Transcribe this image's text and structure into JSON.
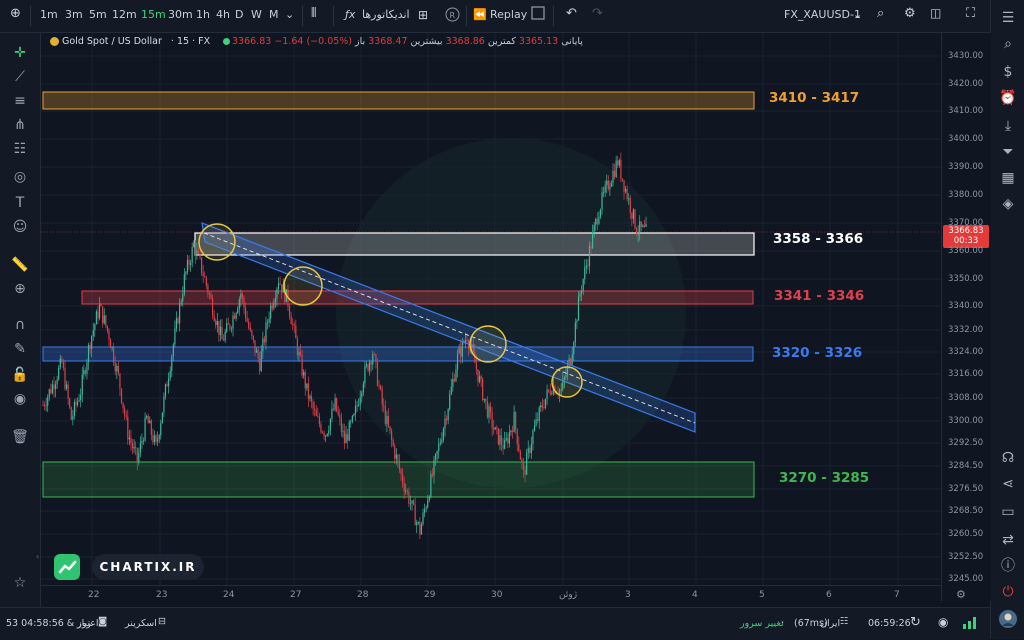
{
  "toolbar": {
    "timeframes": [
      "1m",
      "3m",
      "5m",
      "12m",
      "15m",
      "30m",
      "1h",
      "4h",
      "D",
      "W",
      "M"
    ],
    "active_timeframe": "15m",
    "indicators_label": "اندیکاتورها",
    "replay_label": "Replay",
    "symbol": "FX_XAUUSD-1"
  },
  "legend": {
    "name": "Gold Spot / US Dollar",
    "interval": "15",
    "source": "FX",
    "open_label": "باز",
    "open_value": "3368.47",
    "high_label": "بیشترین",
    "high_value": "3368.86",
    "low_label": "کمترین",
    "low_value": "3365.13",
    "close_label": "پایانی",
    "close_value": "3366.83",
    "change": "−1.64 (−0.05%)"
  },
  "chart_data": {
    "type": "candlestick",
    "symbol": "XAUUSD",
    "interval": "15m",
    "y_ticks": [
      "3430.00",
      "3420.00",
      "3410.00",
      "3400.00",
      "3390.00",
      "3380.00",
      "3370.00",
      "3360.00",
      "3350.00",
      "3340.00",
      "3332.00",
      "3324.00",
      "3316.00",
      "3308.00",
      "3300.00",
      "3292.50",
      "3284.50",
      "3276.50",
      "3268.50",
      "3260.50",
      "3252.50",
      "3245.00"
    ],
    "x_ticks": [
      "22",
      "23",
      "24",
      "27",
      "28",
      "29",
      "30",
      "ژوئن",
      "3",
      "4",
      "5",
      "6",
      "7"
    ],
    "last_price": "3366.83",
    "countdown": "00:33",
    "zones": [
      {
        "label": "3410 - 3417",
        "low": 3410,
        "high": 3417,
        "color": "#f0a030"
      },
      {
        "label": "3358 - 3366",
        "low": 3358,
        "high": 3366,
        "color": "#ffffff"
      },
      {
        "label": "3341 - 3346",
        "low": 3341,
        "high": 3346,
        "color": "#e0404a"
      },
      {
        "label": "3320 - 3326",
        "low": 3320,
        "high": 3326,
        "color": "#3a7bf0"
      },
      {
        "label": "3270 - 3285",
        "low": 3270,
        "high": 3285,
        "color": "#3fb850"
      }
    ],
    "close_series": [
      3305,
      3312,
      3320,
      3300,
      3310,
      3328,
      3340,
      3330,
      3315,
      3295,
      3285,
      3300,
      3290,
      3310,
      3330,
      3350,
      3362,
      3352,
      3340,
      3328,
      3335,
      3345,
      3330,
      3320,
      3338,
      3350,
      3342,
      3325,
      3310,
      3300,
      3295,
      3305,
      3292,
      3300,
      3315,
      3324,
      3305,
      3292,
      3280,
      3270,
      3260,
      3275,
      3290,
      3305,
      3322,
      3330,
      3318,
      3305,
      3295,
      3290,
      3300,
      3280,
      3295,
      3305,
      3312,
      3310,
      3322,
      3345,
      3360,
      3375,
      3384,
      3392,
      3380,
      3368,
      3366.83
    ]
  },
  "watermark": "CHARTIX.IR",
  "status": {
    "credit_label": "اعتبار",
    "credit_value": "53 روز & 04:58:56",
    "screener_label": "اسکرینر",
    "server_change_label": "تغییر سرور",
    "server_name": "ایران",
    "latency": "(67ms)",
    "clock": "06:59:26"
  }
}
